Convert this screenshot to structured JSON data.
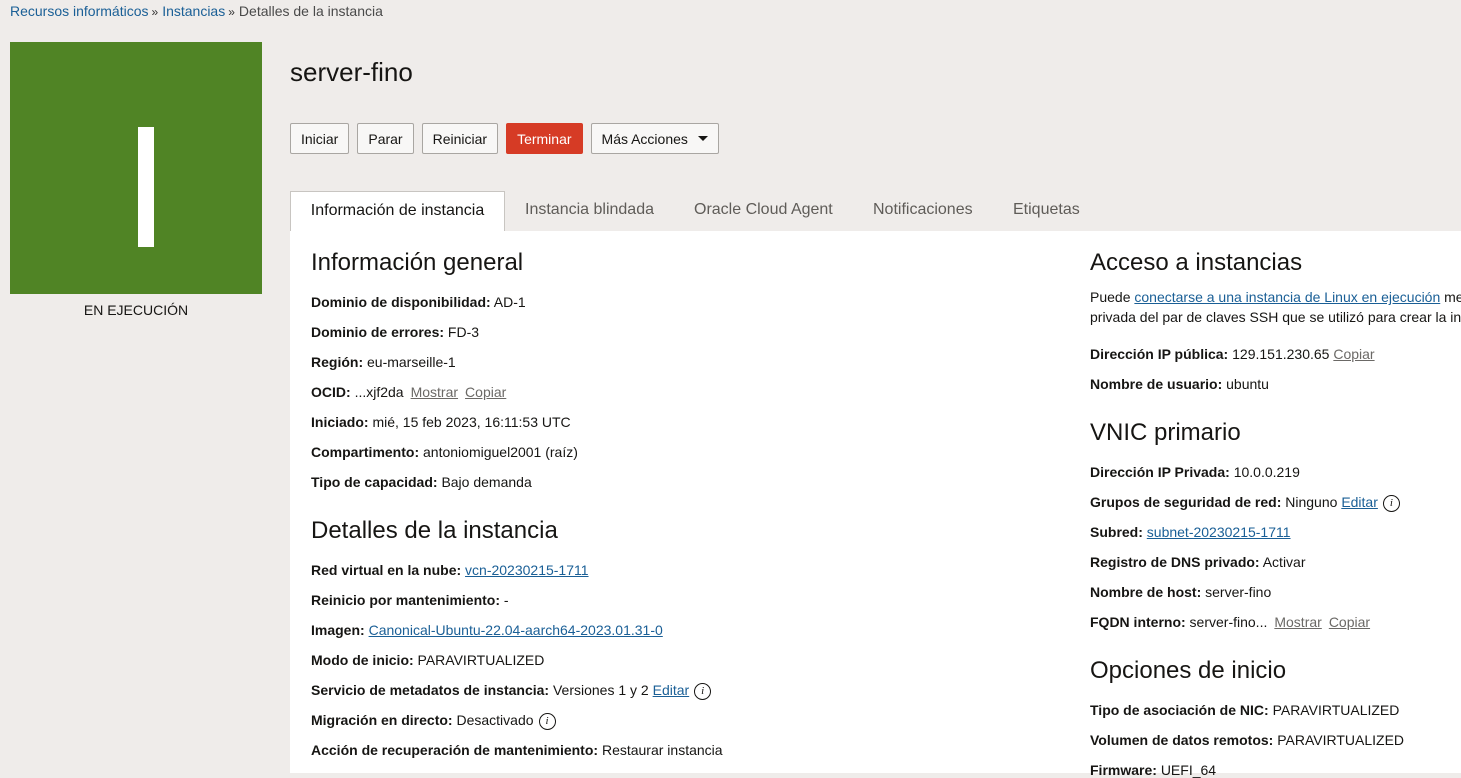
{
  "breadcrumb": {
    "item1": "Recursos informáticos",
    "item2": "Instancias",
    "current": "Detalles de la instancia",
    "separator": "»"
  },
  "status": {
    "letter": "I",
    "label": "EN EJECUCIÓN",
    "color": "#508425"
  },
  "instance_name": "server-fino",
  "actions": {
    "start": "Iniciar",
    "stop": "Parar",
    "reboot": "Reiniciar",
    "terminate": "Terminar",
    "more": "Más Acciones"
  },
  "tabs": [
    "Información de instancia",
    "Instancia blindada",
    "Oracle Cloud Agent",
    "Notificaciones",
    "Etiquetas"
  ],
  "general": {
    "heading": "Información general",
    "availability_domain": {
      "label": "Dominio de disponibilidad:",
      "value": "AD-1"
    },
    "fault_domain": {
      "label": "Dominio de errores:",
      "value": "FD-3"
    },
    "region": {
      "label": "Región:",
      "value": "eu-marseille-1"
    },
    "ocid": {
      "label": "OCID:",
      "value": "...xjf2da",
      "show": "Mostrar",
      "copy": "Copiar"
    },
    "launched": {
      "label": "Iniciado:",
      "value": "mié, 15 feb 2023, 16:11:53 UTC"
    },
    "compartment": {
      "label": "Compartimento:",
      "value": "antoniomiguel2001 (raíz)"
    },
    "capacity": {
      "label": "Tipo de capacidad:",
      "value": "Bajo demanda"
    }
  },
  "details": {
    "heading": "Detalles de la instancia",
    "vcn": {
      "label": "Red virtual en la nube:",
      "value": "vcn-20230215-1711"
    },
    "maintenance_reboot": {
      "label": "Reinicio por mantenimiento:",
      "value": "-"
    },
    "image": {
      "label": "Imagen:",
      "value": "Canonical-Ubuntu-22.04-aarch64-2023.01.31-0"
    },
    "launch_mode": {
      "label": "Modo de inicio:",
      "value": "PARAVIRTUALIZED"
    },
    "metadata_service": {
      "label": "Servicio de metadatos de instancia:",
      "value": "Versiones 1 y 2",
      "edit": "Editar"
    },
    "live_migration": {
      "label": "Migración en directo:",
      "value": "Desactivado"
    },
    "recovery_action": {
      "label": "Acción de recuperación de mantenimiento:",
      "value": "Restaurar instancia"
    }
  },
  "access": {
    "heading": "Acceso a instancias",
    "desc_prefix": "Puede ",
    "desc_link": "conectarse a una instancia de Linux en ejecución",
    "desc_suffix": " me",
    "desc_line2": "privada del par de claves SSH que se utilizó para crear la ins",
    "public_ip": {
      "label": "Dirección IP pública:",
      "value": "129.151.230.65",
      "copy": "Copiar"
    },
    "username": {
      "label": "Nombre de usuario:",
      "value": "ubuntu"
    }
  },
  "vnic": {
    "heading": "VNIC primario",
    "private_ip": {
      "label": "Dirección IP Privada:",
      "value": "10.0.0.219"
    },
    "nsg": {
      "label": "Grupos de seguridad de red:",
      "value": "Ninguno",
      "edit": "Editar"
    },
    "subnet": {
      "label": "Subred:",
      "value": "subnet-20230215-1711"
    },
    "dns_record": {
      "label": "Registro de DNS privado:",
      "value": "Activar"
    },
    "hostname": {
      "label": "Nombre de host:",
      "value": "server-fino"
    },
    "fqdn": {
      "label": "FQDN interno:",
      "value": "server-fino...",
      "show": "Mostrar",
      "copy": "Copiar"
    }
  },
  "launch_options": {
    "heading": "Opciones de inicio",
    "nic_type": {
      "label": "Tipo de asociación de NIC:",
      "value": "PARAVIRTUALIZED"
    },
    "remote_volume": {
      "label": "Volumen de datos remotos:",
      "value": "PARAVIRTUALIZED"
    },
    "firmware": {
      "label": "Firmware:",
      "value": "UEFI_64"
    }
  },
  "info_icon_glyph": "i"
}
